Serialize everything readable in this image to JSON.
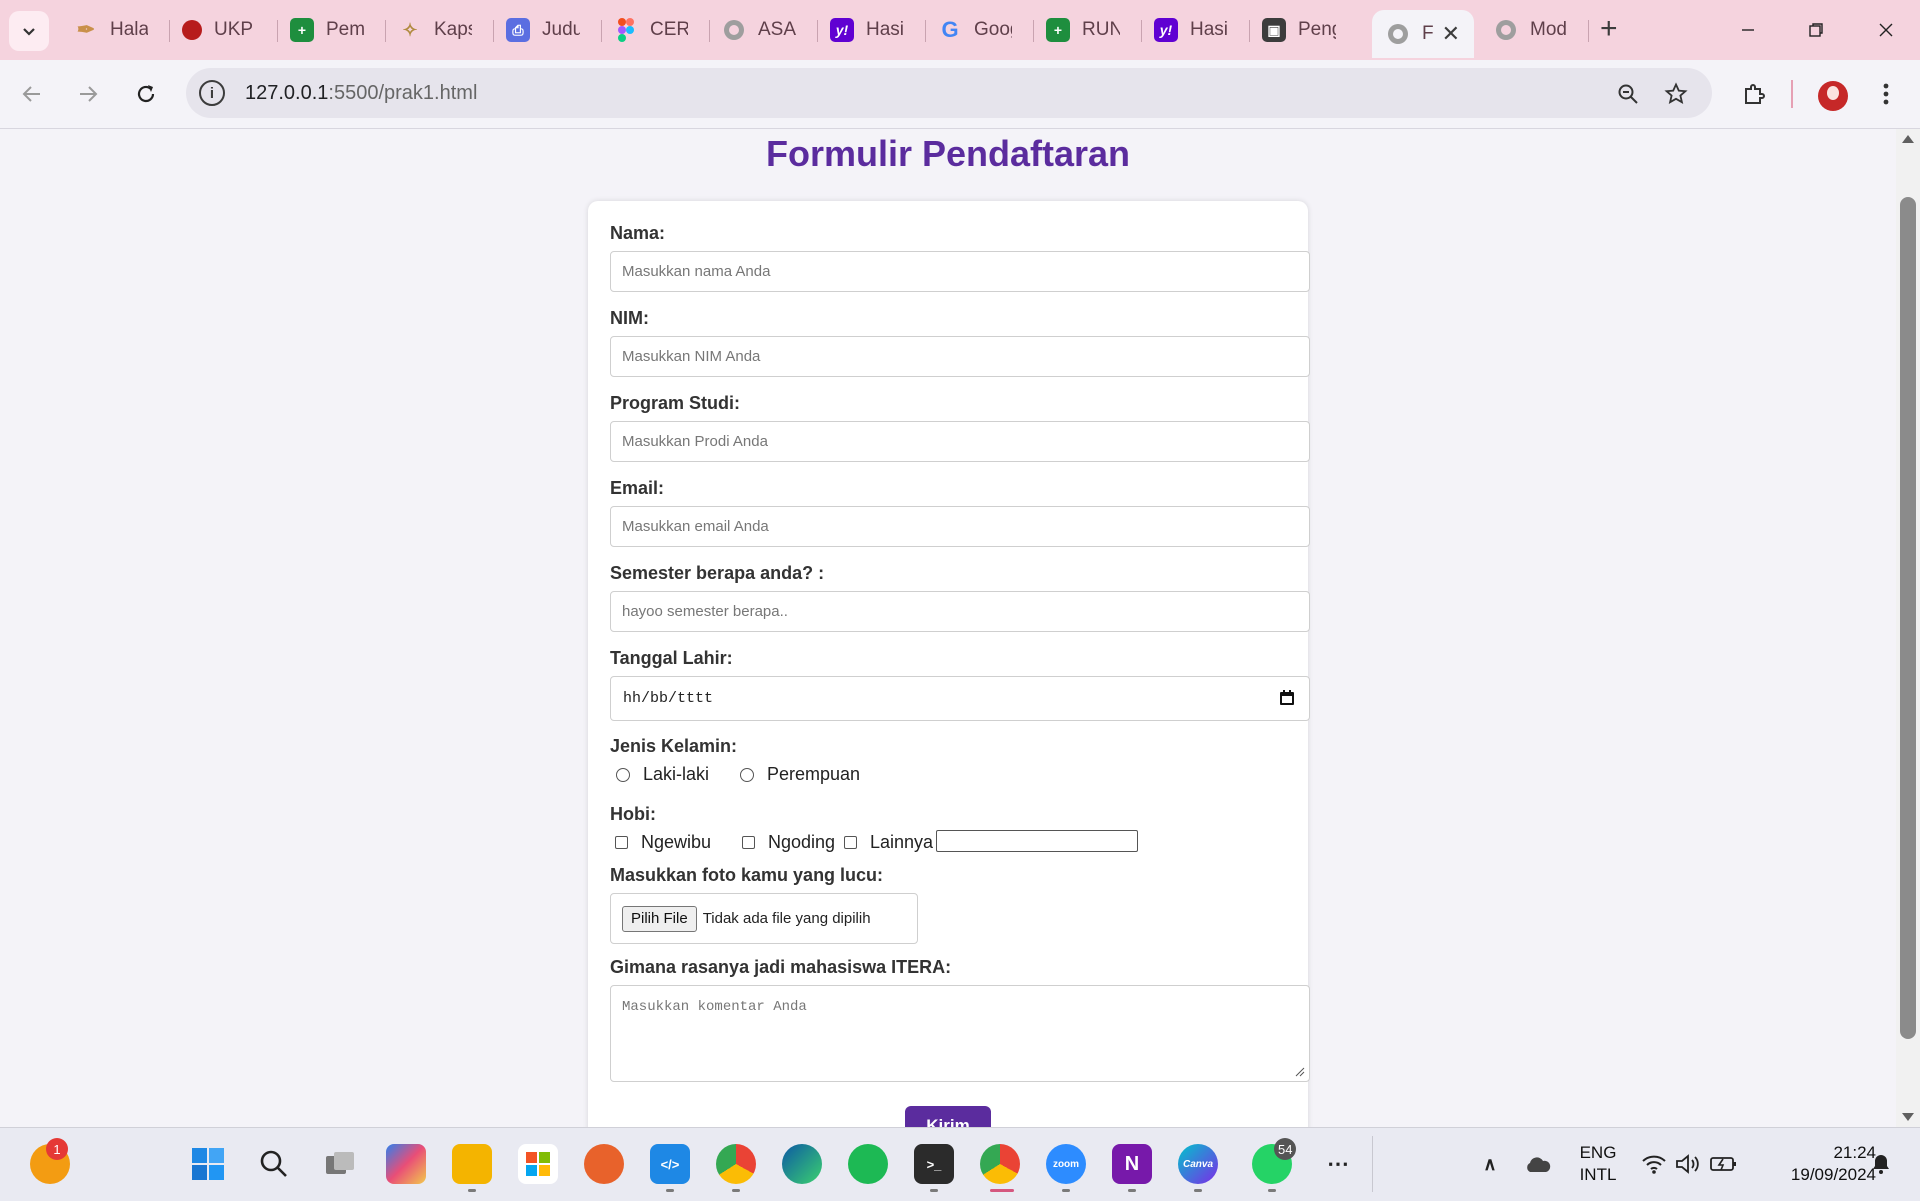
{
  "tabs": [
    {
      "title": "Halaman",
      "icon": "feather-icon",
      "color": "#c9904a"
    },
    {
      "title": "UKPM",
      "icon": "ukpm-logo-icon",
      "color": "#b71c1c"
    },
    {
      "title": "Pembagian",
      "icon": "google-sheets-icon",
      "color": "#1e8e3e"
    },
    {
      "title": "Kapsul",
      "icon": "itera-logo-icon",
      "color": "#b08a3e"
    },
    {
      "title": "Judul",
      "icon": "printer-icon",
      "color": "#5b6ee1"
    },
    {
      "title": "CERITA",
      "icon": "figma-icon",
      "color": "#f24e1e"
    },
    {
      "title": "ASAP",
      "icon": "globe-icon",
      "color": "#9e9e9e"
    },
    {
      "title": "Hasil",
      "icon": "yahoo-icon",
      "color": "#6001d2"
    },
    {
      "title": "Google",
      "icon": "google-icon",
      "color": "#4285f4"
    },
    {
      "title": "RUNDOWN",
      "icon": "google-sheets-icon",
      "color": "#1e8e3e"
    },
    {
      "title": "Hasil",
      "icon": "yahoo-icon",
      "color": "#6001d2"
    },
    {
      "title": "Pengguna",
      "icon": "contact-card-icon",
      "color": "#3c3c3c"
    },
    {
      "title": "Formulir",
      "icon": "globe-icon",
      "color": "#9e9e9e",
      "active": true
    },
    {
      "title": "Modul",
      "icon": "globe-icon",
      "color": "#9e9e9e"
    }
  ],
  "browser": {
    "url_host": "127.0.0.1",
    "url_rest": ":5500/prak1.html"
  },
  "page": {
    "title": "Formulir Pendaftaran",
    "fields": {
      "nama_label": "Nama:",
      "nama_placeholder": "Masukkan nama Anda",
      "nim_label": "NIM:",
      "nim_placeholder": "Masukkan NIM Anda",
      "prodi_label": "Program Studi:",
      "prodi_placeholder": "Masukkan Prodi Anda",
      "email_label": "Email:",
      "email_placeholder": "Masukkan email Anda",
      "semester_label": "Semester berapa anda? :",
      "semester_placeholder": "hayoo semester berapa..",
      "tanggal_label": "Tanggal Lahir:",
      "tanggal_value": "hh/bb/tttt",
      "gender_label": "Jenis Kelamin:",
      "gender_options": [
        "Laki-laki",
        "Perempuan"
      ],
      "hobi_label": "Hobi:",
      "hobi_options": [
        "Ngewibu",
        "Ngoding",
        "Lainnya"
      ],
      "foto_label": "Masukkan foto kamu yang lucu:",
      "file_button": "Pilih File",
      "file_status": "Tidak ada file yang dipilih",
      "komentar_label": "Gimana rasanya jadi mahasiswa ITERA:",
      "komentar_placeholder": "Masukkan komentar Anda",
      "submit_label": "Kirim"
    }
  },
  "taskbar": {
    "notification_badge": "1",
    "whatsapp_badge": "54",
    "lang_top": "ENG",
    "lang_bottom": "INTL",
    "time": "21:24",
    "date": "19/09/2024"
  },
  "colors": {
    "accent": "#5b2c9e",
    "tabbar": "#f5d3de",
    "page_bg": "#f4f3f8"
  }
}
